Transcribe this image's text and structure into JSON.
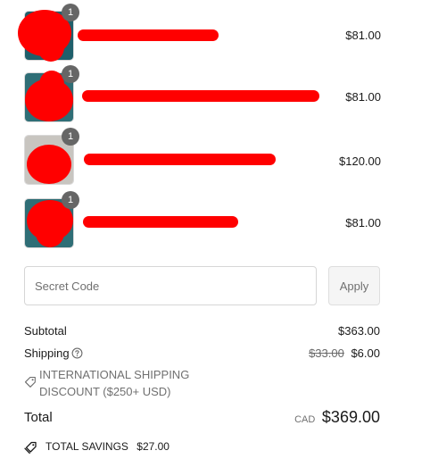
{
  "items": [
    {
      "quantity": "1",
      "price": "$81.00",
      "image_color": "#1f5f6b"
    },
    {
      "quantity": "1",
      "price": "$81.00",
      "image_color": "#2f6e76"
    },
    {
      "quantity": "1",
      "price": "$120.00",
      "image_color": "#c8c5c0"
    },
    {
      "quantity": "1",
      "price": "$81.00",
      "image_color": "#2f6e76"
    }
  ],
  "redaction_color": "#ff0000",
  "discount_code": {
    "placeholder": "Secret Code",
    "apply_label": "Apply"
  },
  "summary": {
    "subtotal_label": "Subtotal",
    "subtotal_value": "$363.00",
    "shipping_label": "Shipping",
    "shipping_original": "$33.00",
    "shipping_value": "$6.00",
    "shipping_discount": "INTERNATIONAL SHIPPING DISCOUNT ($250+ USD)",
    "total_label": "Total",
    "currency": "CAD",
    "total_value": "$369.00",
    "savings_label": "TOTAL SAVINGS",
    "savings_value": "$27.00"
  },
  "icons": {
    "shipping_info": "help-circle-icon",
    "discount": "tag-icon",
    "savings": "tags-icon"
  }
}
